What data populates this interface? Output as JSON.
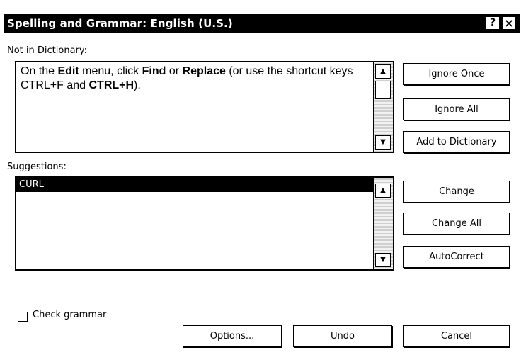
{
  "window": {
    "title": "Spelling and Grammar: English (U.S.)",
    "help_label": "?",
    "close_label": "×"
  },
  "not_in_dictionary": {
    "label": "Not in Dictionary:",
    "text_parts": [
      {
        "t": "On the ",
        "b": false
      },
      {
        "t": "Edit",
        "b": true
      },
      {
        "t": " menu, click ",
        "b": false
      },
      {
        "t": "Find",
        "b": true
      },
      {
        "t": " or ",
        "b": false
      },
      {
        "t": "Replace",
        "b": true
      },
      {
        "t": " (or use the shortcut keys CTRL+F and ",
        "b": false
      },
      {
        "t": "CTRL+H",
        "b": true
      },
      {
        "t": ").",
        "b": false
      }
    ]
  },
  "suggestions": {
    "label": "Suggestions:",
    "items": [
      "CURL"
    ]
  },
  "buttons": {
    "ignore_once": "Ignore Once",
    "ignore_all": "Ignore All",
    "add_to_dictionary": "Add to Dictionary",
    "change": "Change",
    "change_all": "Change All",
    "autocorrect": "AutoCorrect",
    "options": "Options...",
    "undo": "Undo",
    "cancel": "Cancel"
  },
  "check_grammar": {
    "label": "Check grammar",
    "checked": false
  }
}
